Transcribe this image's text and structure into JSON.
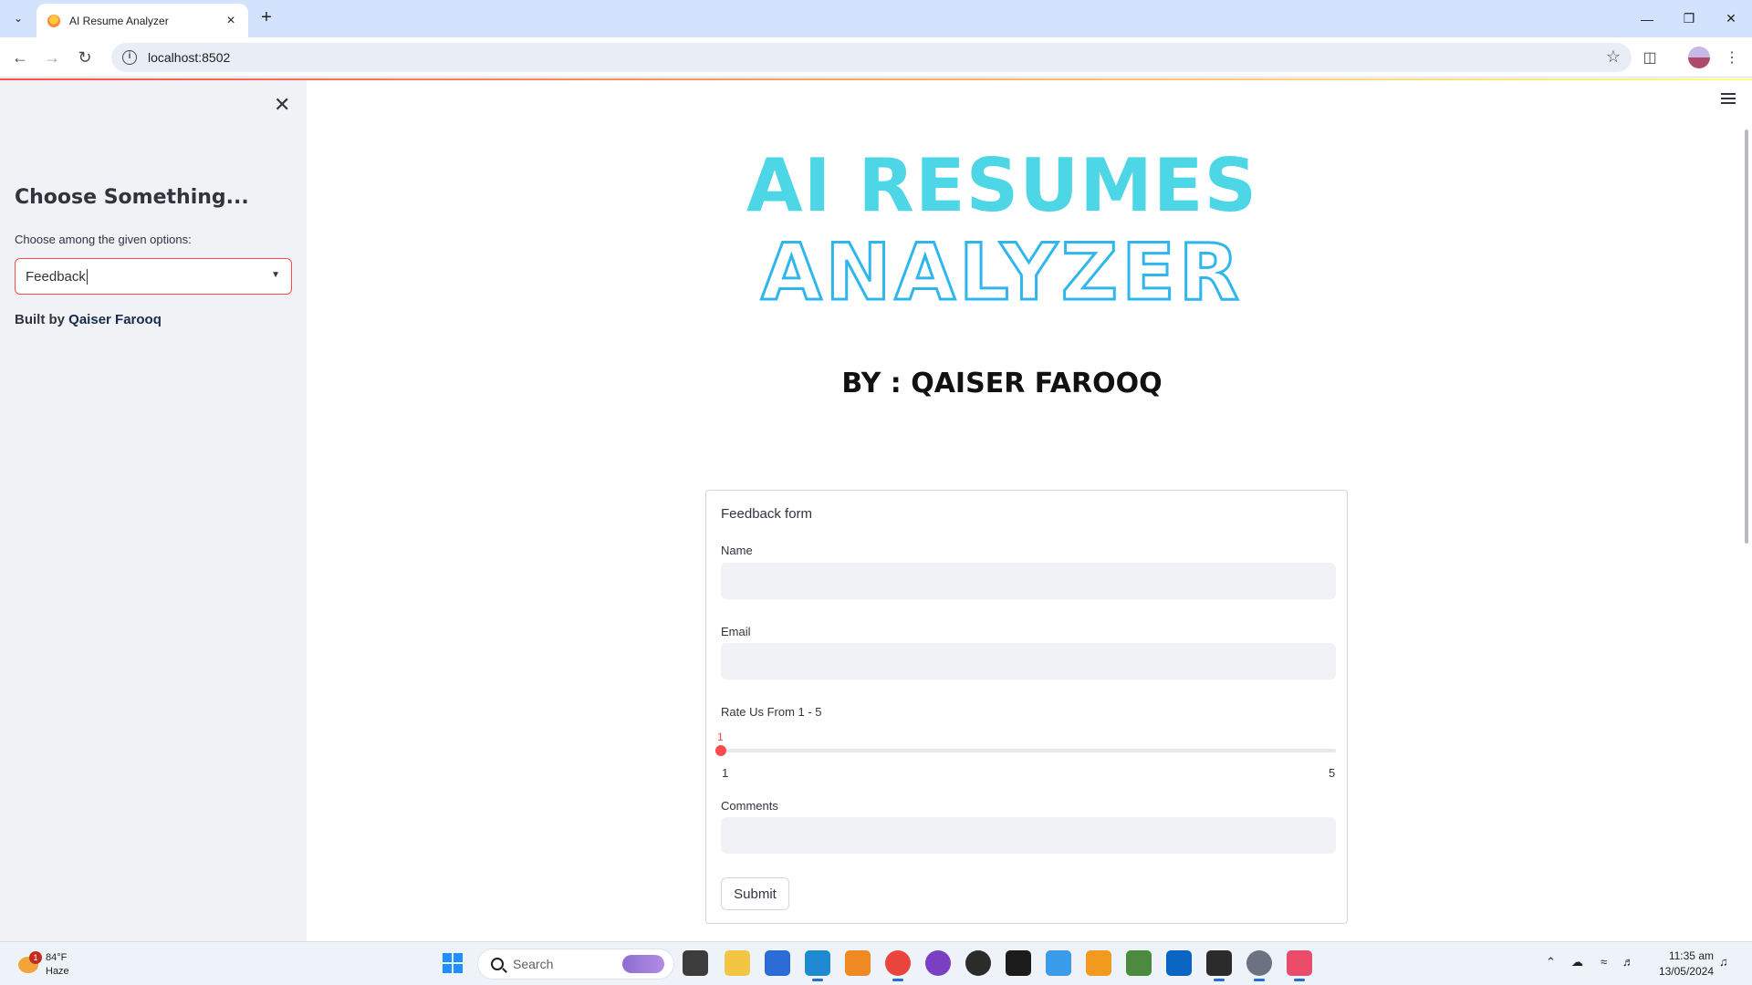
{
  "browser": {
    "tab_title": "AI Resume Analyzer",
    "url": "localhost:8502"
  },
  "sidebar": {
    "heading": "Choose Something...",
    "select_label": "Choose among the given options:",
    "select_value": "Feedback",
    "built_by_prefix": "Built by ",
    "built_by_name": "Qaiser Farooq"
  },
  "main": {
    "title_line1": "AI RESUMES",
    "title_line2": "ANALYZER",
    "byline": "BY : QAISER FAROOQ"
  },
  "form": {
    "title": "Feedback form",
    "name_label": "Name",
    "name_value": "",
    "email_label": "Email",
    "email_value": "",
    "rating_label": "Rate Us From 1 - 5",
    "rating_value": 1,
    "rating_min": "1",
    "rating_max": "5",
    "comments_label": "Comments",
    "comments_value": "",
    "submit_label": "Submit"
  },
  "taskbar": {
    "weather_temp": "84°F",
    "weather_desc": "Haze",
    "weather_badge": "1",
    "search_placeholder": "Search",
    "time": "11:35 am",
    "date": "13/05/2024"
  },
  "colors": {
    "accent": "#ff4b4b",
    "title_fill": "#4dd6e6",
    "title_outline": "#2fb6ec",
    "sidebar_bg": "#f0f2f6"
  }
}
